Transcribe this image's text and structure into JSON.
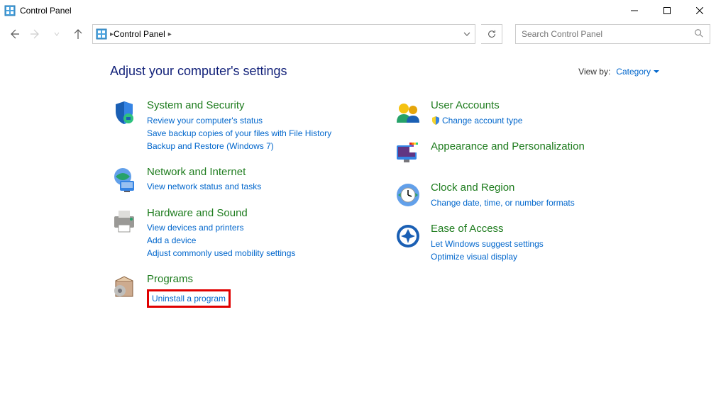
{
  "window": {
    "title": "Control Panel"
  },
  "address": {
    "root": "Control Panel"
  },
  "search": {
    "placeholder": "Search Control Panel"
  },
  "header": {
    "title": "Adjust your computer's settings",
    "viewby_label": "View by:",
    "viewby_value": "Category"
  },
  "left_col": [
    {
      "icon": "shield",
      "title": "System and Security",
      "links": [
        "Review your computer's status",
        "Save backup copies of your files with File History",
        "Backup and Restore (Windows 7)"
      ]
    },
    {
      "icon": "globe",
      "title": "Network and Internet",
      "links": [
        "View network status and tasks"
      ]
    },
    {
      "icon": "printer",
      "title": "Hardware and Sound",
      "links": [
        "View devices and printers",
        "Add a device",
        "Adjust commonly used mobility settings"
      ]
    },
    {
      "icon": "box",
      "title": "Programs",
      "links": [
        "Uninstall a program"
      ],
      "highlight_link": 0
    }
  ],
  "right_col": [
    {
      "icon": "users",
      "title": "User Accounts",
      "links": [
        "Change account type"
      ],
      "shield_links": [
        0
      ]
    },
    {
      "icon": "appearance",
      "title": "Appearance and Personalization",
      "links": []
    },
    {
      "icon": "clock",
      "title": "Clock and Region",
      "links": [
        "Change date, time, or number formats"
      ]
    },
    {
      "icon": "ease",
      "title": "Ease of Access",
      "links": [
        "Let Windows suggest settings",
        "Optimize visual display"
      ]
    }
  ]
}
